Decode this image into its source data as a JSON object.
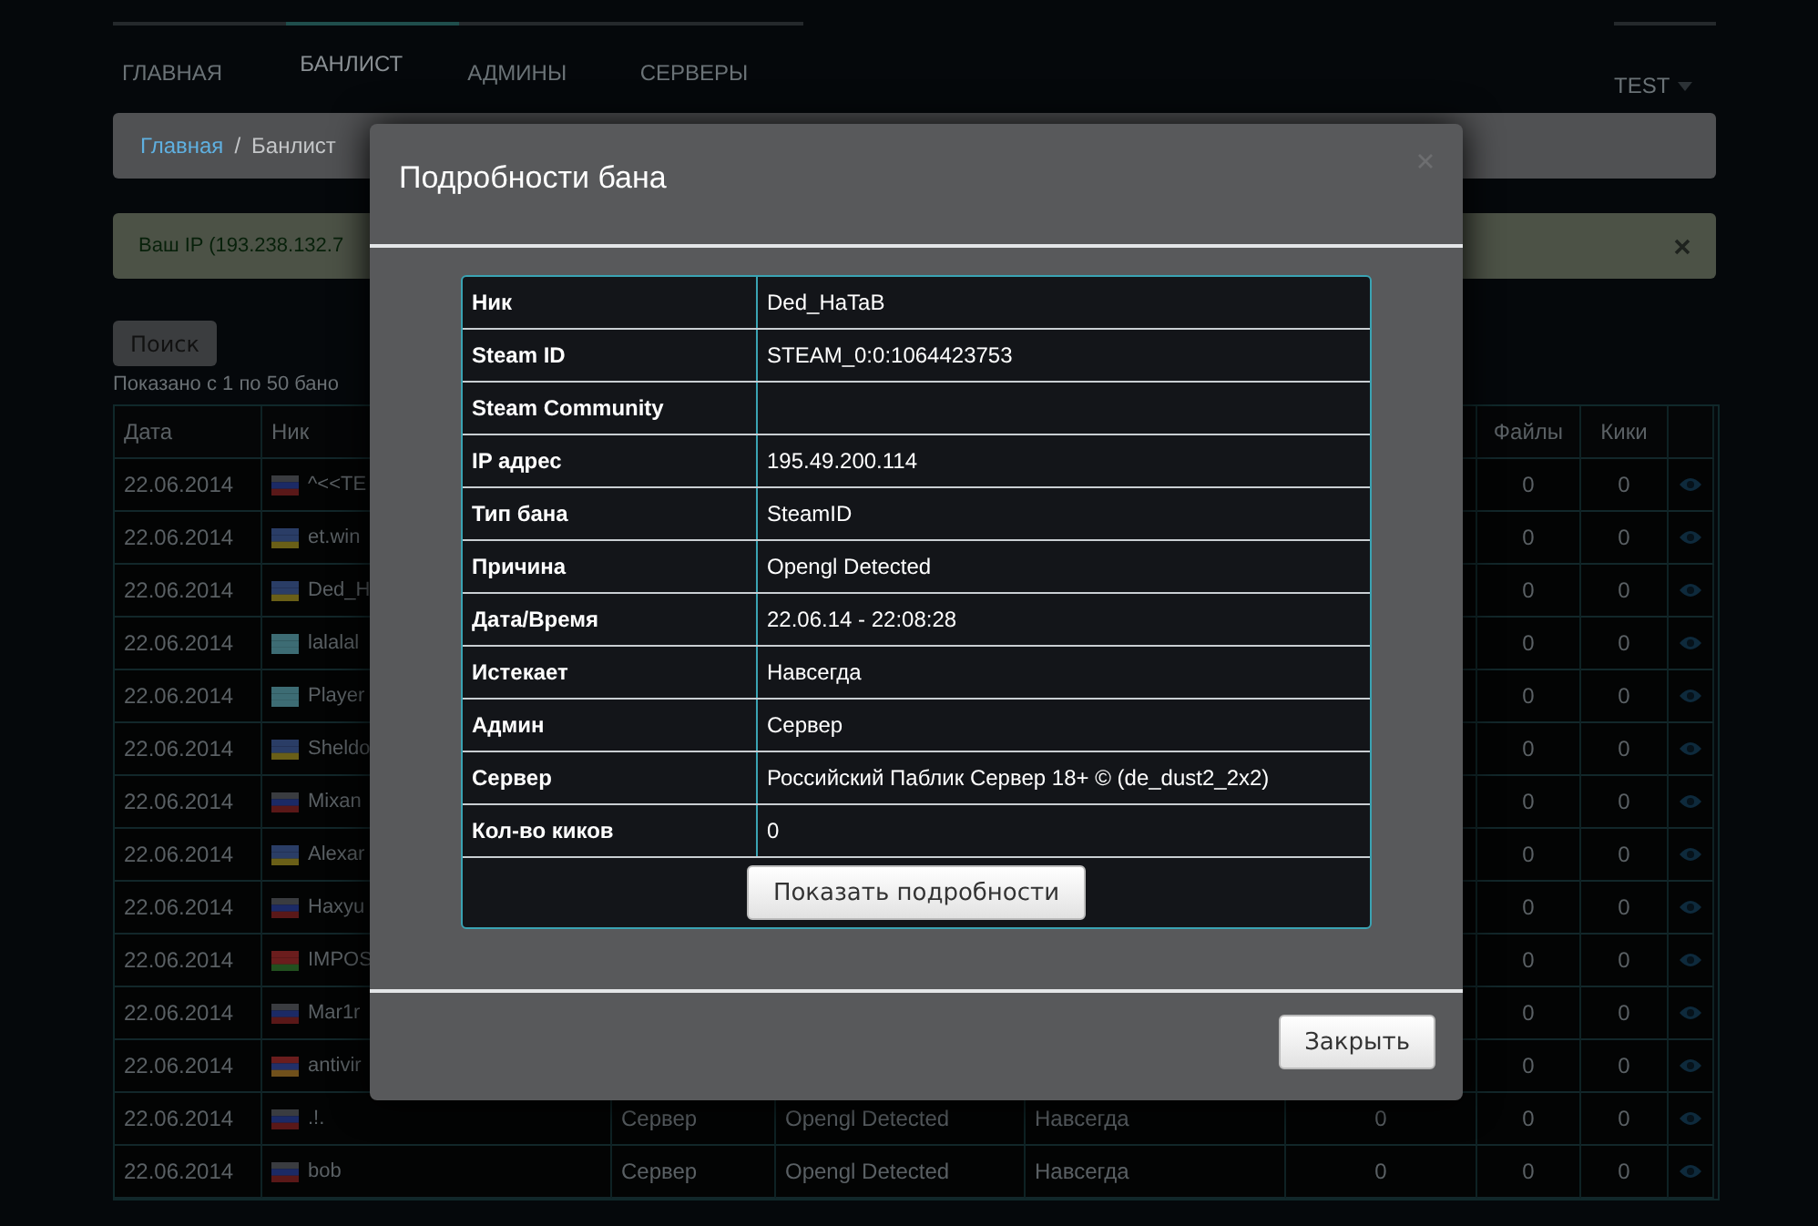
{
  "nav": {
    "items": [
      {
        "label": "ГЛАВНАЯ",
        "selected": false
      },
      {
        "label": "БАНЛИСТ",
        "selected": true
      },
      {
        "label": "АДМИНЫ",
        "selected": false
      },
      {
        "label": "СЕРВЕРЫ",
        "selected": false
      }
    ],
    "user_menu": "TEST"
  },
  "breadcrumb": {
    "separator": "/",
    "items": [
      {
        "label": "Главная",
        "kind": "link"
      },
      {
        "label": "Банлист",
        "kind": "current"
      }
    ]
  },
  "alert": {
    "text": "Ваш IP (193.238.132.7"
  },
  "search_button": "Поиск",
  "results_info": "Показано с 1 по 50 бано",
  "table": {
    "columns_left": [
      "Дата",
      "Ник"
    ],
    "columns_right": [
      "Файлы",
      "Кики"
    ],
    "rows": [
      {
        "date": "22.06.2014",
        "flag": {
          "kind": "ru"
        },
        "nick": "^<<TE",
        "files": "0",
        "kicks": "0"
      },
      {
        "date": "22.06.2014",
        "flag": {
          "kind": "ua"
        },
        "nick": "et.win",
        "files": "0",
        "kicks": "0"
      },
      {
        "date": "22.06.2014",
        "flag": {
          "kind": "ua"
        },
        "nick": "Ded_H",
        "files": "0",
        "kicks": "0"
      },
      {
        "date": "22.06.2014",
        "flag": {
          "kind": "kz"
        },
        "nick": "lalalal",
        "files": "0",
        "kicks": "0"
      },
      {
        "date": "22.06.2014",
        "flag": {
          "kind": "kz"
        },
        "nick": "Player",
        "files": "0",
        "kicks": "0"
      },
      {
        "date": "22.06.2014",
        "flag": {
          "kind": "ua"
        },
        "nick": "Sheldo",
        "files": "0",
        "kicks": "0"
      },
      {
        "date": "22.06.2014",
        "flag": {
          "kind": "ru"
        },
        "nick": "Mixan",
        "files": "0",
        "kicks": "0"
      },
      {
        "date": "22.06.2014",
        "flag": {
          "kind": "ua"
        },
        "nick": "Alexar",
        "files": "0",
        "kicks": "0"
      },
      {
        "date": "22.06.2014",
        "flag": {
          "kind": "ru"
        },
        "nick": "Haxyu",
        "files": "0",
        "kicks": "0"
      },
      {
        "date": "22.06.2014",
        "flag": {
          "kind": "by"
        },
        "nick": "IMPOS",
        "files": "0",
        "kicks": "0"
      },
      {
        "date": "22.06.2014",
        "flag": {
          "kind": "ru"
        },
        "nick": "Mar1r",
        "files": "0",
        "kicks": "0"
      },
      {
        "date": "22.06.2014",
        "flag": {
          "kind": "am"
        },
        "nick": "antivir",
        "files": "0",
        "kicks": "0"
      },
      {
        "date": "22.06.2014",
        "flag": {
          "kind": "ru"
        },
        "nick": ".!.",
        "column_3": "Сервер",
        "column_4": "Opengl Detected",
        "column_5": "Навсегда",
        "column_6": "0",
        "files": "0",
        "kicks": "0"
      },
      {
        "date": "22.06.2014",
        "flag": {
          "kind": "ru"
        },
        "nick": "bob",
        "column_3": "Сервер",
        "column_4": "Opengl Detected",
        "column_5": "Навсегда",
        "column_6": "0",
        "files": "0",
        "kicks": "0"
      }
    ]
  },
  "modal": {
    "title": "Подробности бана",
    "details": [
      {
        "label": "Ник",
        "value": "Ded_HaTaB"
      },
      {
        "label": "Steam ID",
        "value": "STEAM_0:0:1064423753"
      },
      {
        "label": "Steam Community"
      },
      {
        "label": "IP адрес",
        "value": "195.49.200.114"
      },
      {
        "label": "Тип бана",
        "value": "SteamID"
      },
      {
        "label": "Причина",
        "value": "Opengl Detected"
      },
      {
        "label": "Дата/Время",
        "value": "22.06.14 - 22:08:28"
      },
      {
        "label": "Истекает",
        "value": "Навсегда"
      },
      {
        "label": "Админ",
        "value": "Сервер"
      },
      {
        "label": "Сервер",
        "value": "Российский Паблик Сервер 18+ © (de_dust2_2x2)"
      },
      {
        "label": "Кол-во киков",
        "value": "0"
      }
    ],
    "details_button": "Показать подробности",
    "close_button": "Закрыть"
  }
}
